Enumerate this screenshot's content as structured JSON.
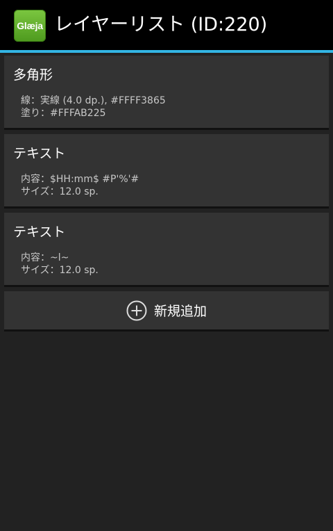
{
  "app": {
    "icon_text": "Glæja",
    "title": "レイヤーリスト (ID:220)"
  },
  "layers": [
    {
      "title": "多角形",
      "line1": "線：実線 (4.0 dp.), #FFFF3865",
      "line2": "塗り：#FFFAB225"
    },
    {
      "title": "テキスト",
      "line1": "内容：$HH:mm$ #P'%'#",
      "line2": "サイズ：12.0 sp."
    },
    {
      "title": "テキスト",
      "line1": "内容：~l~",
      "line2": "サイズ：12.0 sp."
    }
  ],
  "add_button": {
    "icon": "plus-circle-icon",
    "label": "新規追加"
  },
  "colors": {
    "action_bar": "#000000",
    "accent": "#33b5e5",
    "background": "#222222",
    "card": "#333333"
  }
}
